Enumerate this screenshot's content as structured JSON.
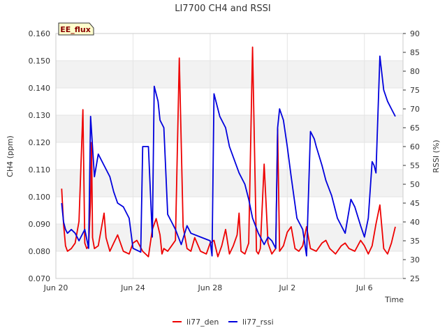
{
  "chart_data": {
    "type": "line",
    "title": "LI7700 CH4 and RSSI",
    "xlabel": "Time",
    "ylabel_left": "CH4 (ppm)",
    "ylabel_right": "RSSI (%)",
    "badge": "EE_flux",
    "x_range": [
      "2024-06-20",
      "2024-07-08"
    ],
    "x_ticks": [
      "Jun 20",
      "Jun 24",
      "Jun 28",
      "Jul 2",
      "Jul 6"
    ],
    "ylim_left": [
      0.07,
      0.16
    ],
    "yticks_left": [
      "0.070",
      "0.080",
      "0.090",
      "0.100",
      "0.110",
      "0.120",
      "0.130",
      "0.140",
      "0.150",
      "0.160"
    ],
    "ylim_right": [
      25,
      90
    ],
    "yticks_right": [
      "25",
      "30",
      "35",
      "40",
      "45",
      "50",
      "55",
      "60",
      "65",
      "70",
      "75",
      "80",
      "85",
      "90"
    ],
    "grid": true,
    "band_color": "#f2f2f2",
    "legend_position": "bottom-center",
    "series": [
      {
        "name": "li77_den",
        "color": "#ee0000",
        "axis": "left",
        "x": [
          20.3,
          20.4,
          20.5,
          20.6,
          20.8,
          21.0,
          21.2,
          21.4,
          21.5,
          21.6,
          21.7,
          21.8,
          21.85,
          21.9,
          22.0,
          22.2,
          22.5,
          22.6,
          22.8,
          23.0,
          23.2,
          23.5,
          23.8,
          24.0,
          24.2,
          24.5,
          24.8,
          25.0,
          25.2,
          25.4,
          25.5,
          25.6,
          25.8,
          26.0,
          26.2,
          26.4,
          26.6,
          26.8,
          27.0,
          27.2,
          27.5,
          27.8,
          28.0,
          28.2,
          28.4,
          28.6,
          28.8,
          29.0,
          29.2,
          29.4,
          29.5,
          29.6,
          29.8,
          30.0,
          30.2,
          30.4,
          30.5,
          30.6,
          30.8,
          31.0,
          31.2,
          31.4,
          31.5,
          31.6,
          31.8,
          32.0,
          32.2,
          32.4,
          32.6,
          32.8,
          33.0,
          33.2,
          33.5,
          33.8,
          34.0,
          34.2,
          34.5,
          34.8,
          35.0,
          35.2,
          35.5,
          35.8,
          36.0,
          36.2,
          36.4,
          36.6,
          36.8,
          37.0,
          37.2,
          37.4,
          37.6
        ],
        "y": [
          0.103,
          0.09,
          0.082,
          0.08,
          0.081,
          0.083,
          0.091,
          0.132,
          0.083,
          0.081,
          0.082,
          0.098,
          0.12,
          0.085,
          0.081,
          0.082,
          0.094,
          0.085,
          0.08,
          0.083,
          0.086,
          0.08,
          0.079,
          0.083,
          0.084,
          0.08,
          0.078,
          0.088,
          0.092,
          0.086,
          0.079,
          0.081,
          0.08,
          0.082,
          0.084,
          0.151,
          0.089,
          0.081,
          0.08,
          0.085,
          0.08,
          0.079,
          0.083,
          0.084,
          0.078,
          0.082,
          0.088,
          0.079,
          0.082,
          0.086,
          0.094,
          0.08,
          0.079,
          0.083,
          0.155,
          0.08,
          0.079,
          0.081,
          0.112,
          0.083,
          0.079,
          0.081,
          0.125,
          0.08,
          0.082,
          0.087,
          0.089,
          0.081,
          0.08,
          0.082,
          0.089,
          0.081,
          0.08,
          0.083,
          0.084,
          0.081,
          0.079,
          0.082,
          0.083,
          0.081,
          0.08,
          0.084,
          0.082,
          0.079,
          0.082,
          0.09,
          0.097,
          0.081,
          0.079,
          0.083,
          0.089
        ]
      },
      {
        "name": "li77_rssi",
        "color": "#0000dd",
        "axis": "right",
        "x": [
          20.3,
          20.4,
          20.5,
          20.6,
          20.8,
          21.0,
          21.2,
          21.5,
          21.7,
          21.8,
          22.0,
          22.2,
          22.5,
          22.8,
          23.0,
          23.2,
          23.5,
          23.8,
          24.0,
          24.4,
          24.5,
          24.8,
          25.0,
          25.1,
          25.3,
          25.4,
          25.6,
          25.8,
          26.0,
          26.2,
          26.5,
          26.8,
          27.0,
          27.5,
          28.0,
          28.1,
          28.2,
          28.5,
          28.8,
          29.0,
          29.5,
          29.8,
          30.0,
          30.2,
          30.5,
          30.8,
          31.0,
          31.2,
          31.4,
          31.5,
          31.6,
          31.8,
          32.0,
          32.2,
          32.5,
          32.8,
          33.0,
          33.2,
          33.4,
          33.5,
          33.8,
          34.0,
          34.3,
          34.6,
          35.0,
          35.3,
          35.5,
          35.8,
          36.0,
          36.2,
          36.4,
          36.5,
          36.6,
          36.8,
          37.0,
          37.2,
          37.4,
          37.6
        ],
        "y": [
          45,
          40,
          38,
          37,
          38,
          37,
          35,
          38,
          33,
          68,
          52,
          58,
          55,
          52,
          48,
          45,
          44,
          41,
          33,
          32,
          60,
          60,
          36,
          76,
          72,
          67,
          65,
          42,
          40,
          38,
          34,
          39,
          37,
          36,
          35,
          31,
          74,
          68,
          65,
          60,
          53,
          50,
          46,
          41,
          37,
          34,
          36,
          35,
          33,
          65,
          70,
          67,
          60,
          52,
          41,
          38,
          31,
          64,
          62,
          60,
          55,
          51,
          47,
          41,
          37,
          46,
          44,
          39,
          36,
          41,
          56,
          55,
          53,
          84,
          75,
          72,
          70,
          68
        ]
      }
    ]
  }
}
